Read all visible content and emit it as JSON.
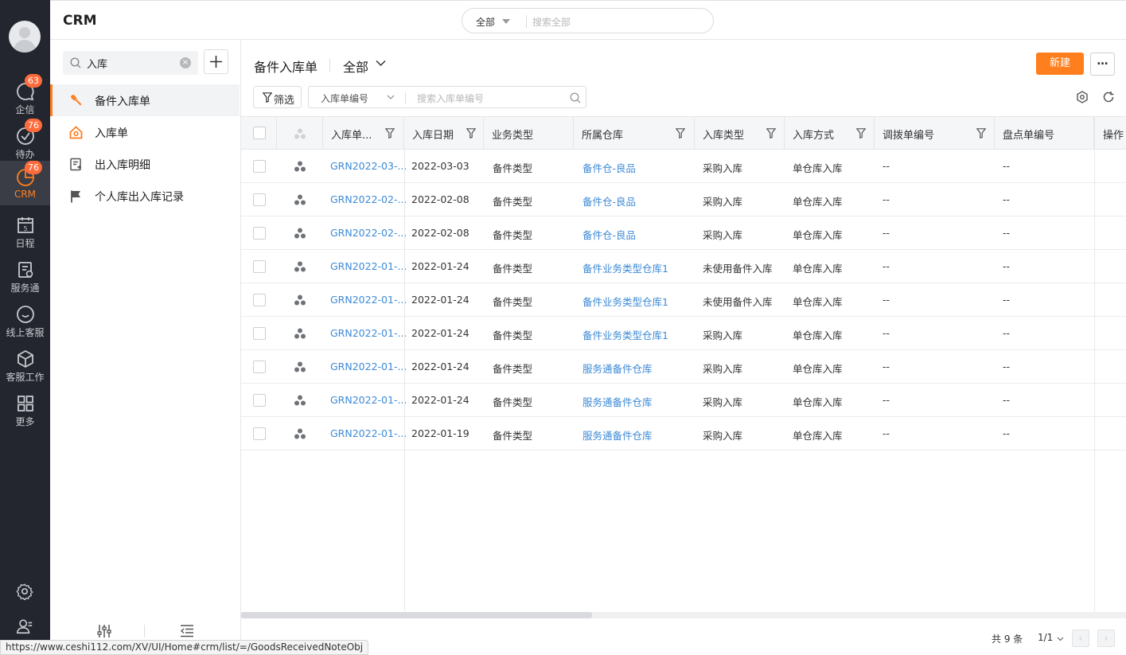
{
  "rail": {
    "items": [
      {
        "label": "企信",
        "badge": "63"
      },
      {
        "label": "待办",
        "badge": "76"
      },
      {
        "label": "CRM",
        "badge": "76"
      },
      {
        "label": "日程",
        "badge": ""
      },
      {
        "label": "服务通",
        "badge": ""
      },
      {
        "label": "线上客服",
        "badge": ""
      },
      {
        "label": "客服工作",
        "badge": ""
      },
      {
        "label": "更多",
        "badge": ""
      }
    ]
  },
  "header": {
    "app_title": "CRM",
    "search_scope": "全部",
    "search_placeholder": "搜索全部"
  },
  "menu": {
    "search_value": "入库",
    "items": [
      {
        "label": "备件入库单",
        "icon": "wrench-icon"
      },
      {
        "label": "入库单",
        "icon": "house-icon"
      },
      {
        "label": "出入库明细",
        "icon": "list-doc-icon"
      },
      {
        "label": "个人库出入库记录",
        "icon": "flag-icon"
      }
    ]
  },
  "main": {
    "title": "备件入库单",
    "view": "全部",
    "new_button": "新建",
    "more_button": "…",
    "filter_button": "筛选",
    "search_field": "入库单编号",
    "search_placeholder": "搜索入库单编号",
    "accent_color": "#ff7f1e",
    "link_color": "#3c8ad6"
  },
  "table": {
    "columns": [
      "入库单...",
      "入库日期",
      "业务类型",
      "所属仓库",
      "入库类型",
      "入库方式",
      "调拨单编号",
      "盘点单编号",
      "操作"
    ],
    "rows": [
      [
        "GRN2022-03-...",
        "2022-03-03",
        "备件类型",
        "备件仓-良品",
        "采购入库",
        "单仓库入库",
        "--",
        "--"
      ],
      [
        "GRN2022-02-...",
        "2022-02-08",
        "备件类型",
        "备件仓-良品",
        "采购入库",
        "单仓库入库",
        "--",
        "--"
      ],
      [
        "GRN2022-02-...",
        "2022-02-08",
        "备件类型",
        "备件仓-良品",
        "采购入库",
        "单仓库入库",
        "--",
        "--"
      ],
      [
        "GRN2022-01-...",
        "2022-01-24",
        "备件类型",
        "备件业务类型仓库1",
        "未使用备件入库",
        "单仓库入库",
        "--",
        "--"
      ],
      [
        "GRN2022-01-...",
        "2022-01-24",
        "备件类型",
        "备件业务类型仓库1",
        "未使用备件入库",
        "单仓库入库",
        "--",
        "--"
      ],
      [
        "GRN2022-01-...",
        "2022-01-24",
        "备件类型",
        "备件业务类型仓库1",
        "采购入库",
        "单仓库入库",
        "--",
        "--"
      ],
      [
        "GRN2022-01-...",
        "2022-01-24",
        "备件类型",
        "服务通备件仓库",
        "采购入库",
        "单仓库入库",
        "--",
        "--"
      ],
      [
        "GRN2022-01-...",
        "2022-01-24",
        "备件类型",
        "服务通备件仓库",
        "采购入库",
        "单仓库入库",
        "--",
        "--"
      ],
      [
        "GRN2022-01-...",
        "2022-01-19",
        "备件类型",
        "服务通备件仓库",
        "采购入库",
        "单仓库入库",
        "--",
        "--"
      ]
    ]
  },
  "pager": {
    "total": "共 9 条",
    "page": "1/1",
    "prev": "‹",
    "next": "›"
  },
  "statusbar": {
    "url": "https://www.ceshi112.com/XV/UI/Home#crm/list/=/GoodsReceivedNoteObj"
  }
}
